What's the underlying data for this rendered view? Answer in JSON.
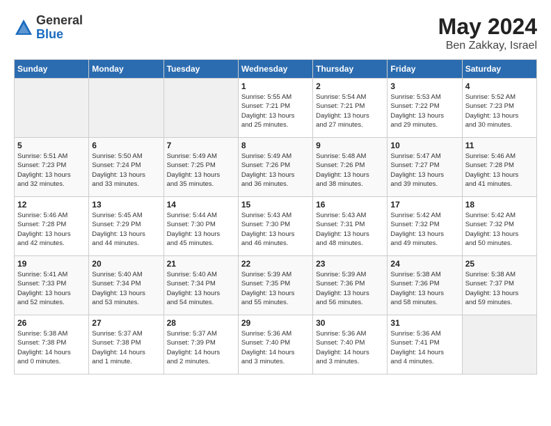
{
  "logo": {
    "general": "General",
    "blue": "Blue"
  },
  "title": "May 2024",
  "location": "Ben Zakkay, Israel",
  "weekdays": [
    "Sunday",
    "Monday",
    "Tuesday",
    "Wednesday",
    "Thursday",
    "Friday",
    "Saturday"
  ],
  "weeks": [
    [
      {
        "day": "",
        "info": ""
      },
      {
        "day": "",
        "info": ""
      },
      {
        "day": "",
        "info": ""
      },
      {
        "day": "1",
        "info": "Sunrise: 5:55 AM\nSunset: 7:21 PM\nDaylight: 13 hours\nand 25 minutes."
      },
      {
        "day": "2",
        "info": "Sunrise: 5:54 AM\nSunset: 7:21 PM\nDaylight: 13 hours\nand 27 minutes."
      },
      {
        "day": "3",
        "info": "Sunrise: 5:53 AM\nSunset: 7:22 PM\nDaylight: 13 hours\nand 29 minutes."
      },
      {
        "day": "4",
        "info": "Sunrise: 5:52 AM\nSunset: 7:23 PM\nDaylight: 13 hours\nand 30 minutes."
      }
    ],
    [
      {
        "day": "5",
        "info": "Sunrise: 5:51 AM\nSunset: 7:23 PM\nDaylight: 13 hours\nand 32 minutes."
      },
      {
        "day": "6",
        "info": "Sunrise: 5:50 AM\nSunset: 7:24 PM\nDaylight: 13 hours\nand 33 minutes."
      },
      {
        "day": "7",
        "info": "Sunrise: 5:49 AM\nSunset: 7:25 PM\nDaylight: 13 hours\nand 35 minutes."
      },
      {
        "day": "8",
        "info": "Sunrise: 5:49 AM\nSunset: 7:26 PM\nDaylight: 13 hours\nand 36 minutes."
      },
      {
        "day": "9",
        "info": "Sunrise: 5:48 AM\nSunset: 7:26 PM\nDaylight: 13 hours\nand 38 minutes."
      },
      {
        "day": "10",
        "info": "Sunrise: 5:47 AM\nSunset: 7:27 PM\nDaylight: 13 hours\nand 39 minutes."
      },
      {
        "day": "11",
        "info": "Sunrise: 5:46 AM\nSunset: 7:28 PM\nDaylight: 13 hours\nand 41 minutes."
      }
    ],
    [
      {
        "day": "12",
        "info": "Sunrise: 5:46 AM\nSunset: 7:28 PM\nDaylight: 13 hours\nand 42 minutes."
      },
      {
        "day": "13",
        "info": "Sunrise: 5:45 AM\nSunset: 7:29 PM\nDaylight: 13 hours\nand 44 minutes."
      },
      {
        "day": "14",
        "info": "Sunrise: 5:44 AM\nSunset: 7:30 PM\nDaylight: 13 hours\nand 45 minutes."
      },
      {
        "day": "15",
        "info": "Sunrise: 5:43 AM\nSunset: 7:30 PM\nDaylight: 13 hours\nand 46 minutes."
      },
      {
        "day": "16",
        "info": "Sunrise: 5:43 AM\nSunset: 7:31 PM\nDaylight: 13 hours\nand 48 minutes."
      },
      {
        "day": "17",
        "info": "Sunrise: 5:42 AM\nSunset: 7:32 PM\nDaylight: 13 hours\nand 49 minutes."
      },
      {
        "day": "18",
        "info": "Sunrise: 5:42 AM\nSunset: 7:32 PM\nDaylight: 13 hours\nand 50 minutes."
      }
    ],
    [
      {
        "day": "19",
        "info": "Sunrise: 5:41 AM\nSunset: 7:33 PM\nDaylight: 13 hours\nand 52 minutes."
      },
      {
        "day": "20",
        "info": "Sunrise: 5:40 AM\nSunset: 7:34 PM\nDaylight: 13 hours\nand 53 minutes."
      },
      {
        "day": "21",
        "info": "Sunrise: 5:40 AM\nSunset: 7:34 PM\nDaylight: 13 hours\nand 54 minutes."
      },
      {
        "day": "22",
        "info": "Sunrise: 5:39 AM\nSunset: 7:35 PM\nDaylight: 13 hours\nand 55 minutes."
      },
      {
        "day": "23",
        "info": "Sunrise: 5:39 AM\nSunset: 7:36 PM\nDaylight: 13 hours\nand 56 minutes."
      },
      {
        "day": "24",
        "info": "Sunrise: 5:38 AM\nSunset: 7:36 PM\nDaylight: 13 hours\nand 58 minutes."
      },
      {
        "day": "25",
        "info": "Sunrise: 5:38 AM\nSunset: 7:37 PM\nDaylight: 13 hours\nand 59 minutes."
      }
    ],
    [
      {
        "day": "26",
        "info": "Sunrise: 5:38 AM\nSunset: 7:38 PM\nDaylight: 14 hours\nand 0 minutes."
      },
      {
        "day": "27",
        "info": "Sunrise: 5:37 AM\nSunset: 7:38 PM\nDaylight: 14 hours\nand 1 minute."
      },
      {
        "day": "28",
        "info": "Sunrise: 5:37 AM\nSunset: 7:39 PM\nDaylight: 14 hours\nand 2 minutes."
      },
      {
        "day": "29",
        "info": "Sunrise: 5:36 AM\nSunset: 7:40 PM\nDaylight: 14 hours\nand 3 minutes."
      },
      {
        "day": "30",
        "info": "Sunrise: 5:36 AM\nSunset: 7:40 PM\nDaylight: 14 hours\nand 3 minutes."
      },
      {
        "day": "31",
        "info": "Sunrise: 5:36 AM\nSunset: 7:41 PM\nDaylight: 14 hours\nand 4 minutes."
      },
      {
        "day": "",
        "info": ""
      }
    ]
  ]
}
